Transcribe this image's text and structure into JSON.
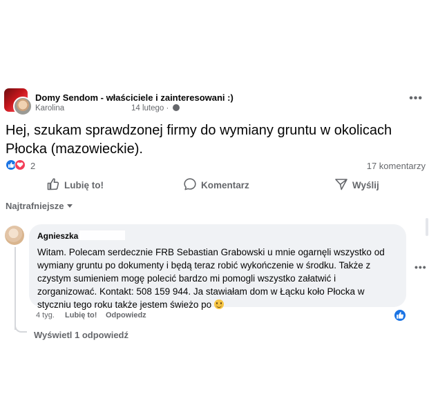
{
  "post": {
    "group_name": "Domy Sendom - właściciele i zainteresowani :)",
    "author": "Karolina",
    "date": "14 lutego ·",
    "text": "Hej, szukam sprawdzonej firmy do wymiany gruntu w okolicach Płocka (mazowieckie).",
    "reaction_count": "2",
    "comments_count": "17 komentarzy",
    "more_icon": "•••"
  },
  "actions": {
    "like_label": "Lubię to!",
    "comment_label": "Komentarz",
    "share_label": "Wyślij"
  },
  "sort": {
    "label": "Najtrafniejsze"
  },
  "comment": {
    "author": "Agnieszka",
    "text": "Witam. Polecam serdecznie FRB Sebastian Grabowski u mnie ogarnęli wszystko od wymiany gruntu po dokumenty i będą teraz robić wykończenie w środku. Także z czystym sumieniem mogę polecić bardzo mi pomogli wszystko załatwić i zorganizować. Kontakt: 508 159 944. Ja stawiałam dom w Łącku koło Płocka w styczniu tego roku także jestem świeżo po",
    "time": "4 tyg.",
    "like_label": "Lubię to!",
    "reply_label": "Odpowiedz",
    "more_icon": "•••"
  },
  "replies": {
    "view_label": "Wyświetl 1 odpowiedź"
  },
  "colors": {
    "like_blue": "#1b74e4",
    "love_red": "#f33e58",
    "muted_text": "#65676b",
    "bubble_bg": "#f0f2f5"
  }
}
